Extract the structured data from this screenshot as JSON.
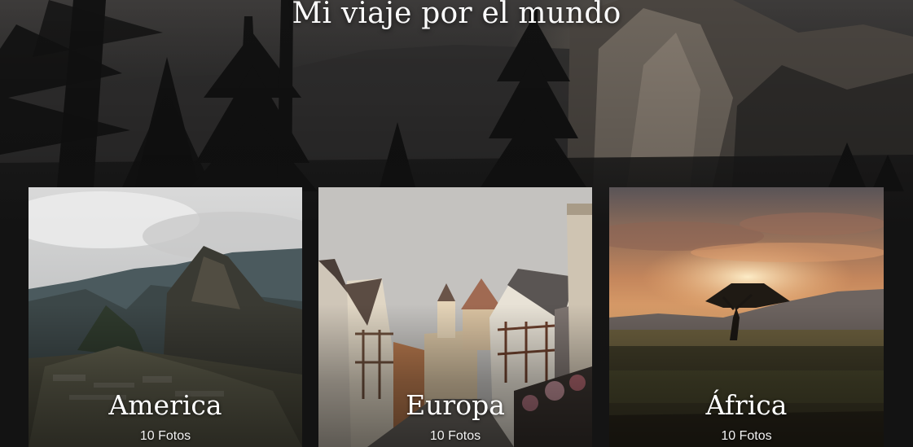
{
  "page": {
    "title": "Mi viaje por el mundo"
  },
  "albums": [
    {
      "name": "America",
      "count_label": "10 Fotos",
      "image": "machu-picchu-photo"
    },
    {
      "name": "Europa",
      "count_label": "10 Fotos",
      "image": "old-town-street-photo"
    },
    {
      "name": "África",
      "count_label": "10 Fotos",
      "image": "savanna-sunset-photo"
    }
  ],
  "colors": {
    "background": "#151515",
    "text": "#ffffff"
  }
}
